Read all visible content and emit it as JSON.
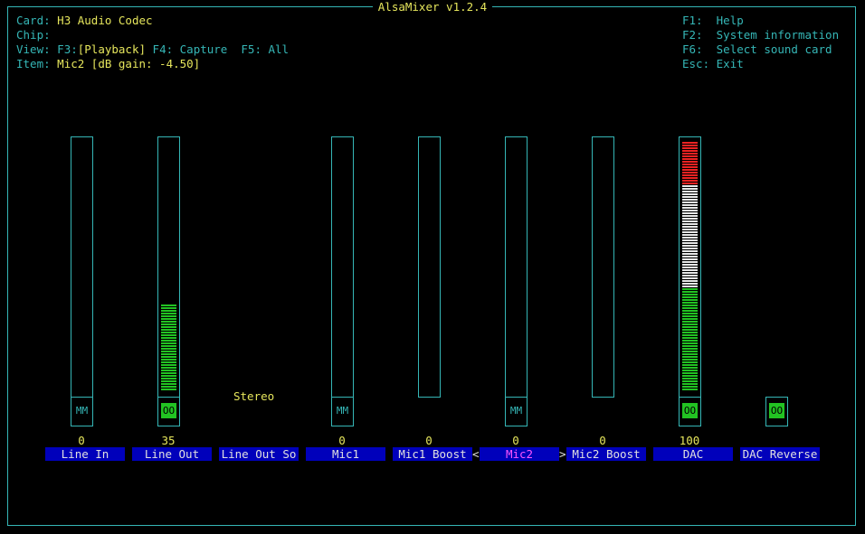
{
  "title": "AlsaMixer v1.2.4",
  "info": {
    "card_label": "Card:",
    "card_value": "H3 Audio Codec",
    "chip_label": "Chip:",
    "chip_value": "",
    "view_label": "View:",
    "view_f3": "F3:",
    "view_playback": "[Playback]",
    "view_f4": "F4: Capture",
    "view_f5": "F5: All",
    "item_label": "Item:",
    "item_value": "Mic2 [dB gain: -4.50]"
  },
  "help": [
    {
      "key": "F1:",
      "text": "Help"
    },
    {
      "key": "F2:",
      "text": "System information"
    },
    {
      "key": "F6:",
      "text": "Select sound card"
    },
    {
      "key": "Esc:",
      "text": "Exit"
    }
  ],
  "stereo_label": "Stereo",
  "colors": {
    "frame": "#35b6b6",
    "highlight": "#e6e65c",
    "green": "#22c322",
    "white": "#e8e8e8",
    "red": "#ee2222",
    "label_bg": "#0000bb",
    "selected": "#ff55ff"
  },
  "controls": [
    {
      "name": "Line In",
      "volume": "0",
      "level": 0,
      "switch": "MM"
    },
    {
      "name": "Line Out",
      "volume": "35",
      "level": 0.35,
      "switch": "OO"
    },
    {
      "name": "Line Out So",
      "volume": "",
      "level": null,
      "switch": ""
    },
    {
      "name": "Mic1",
      "volume": "0",
      "level": 0,
      "switch": "MM"
    },
    {
      "name": "Mic1 Boost",
      "volume": "0",
      "level": 0,
      "switch": ""
    },
    {
      "name": "Mic2",
      "volume": "0",
      "level": 0,
      "switch": "MM",
      "selected": true
    },
    {
      "name": "Mic2 Boost",
      "volume": "0",
      "level": 0,
      "switch": ""
    },
    {
      "name": "DAC",
      "volume": "100",
      "level": 1.0,
      "switch": "OO"
    },
    {
      "name": "DAC Reverse",
      "volume": "",
      "level": null,
      "switch": "OO"
    }
  ],
  "selection_left_marker": "<",
  "selection_right_marker": ">"
}
